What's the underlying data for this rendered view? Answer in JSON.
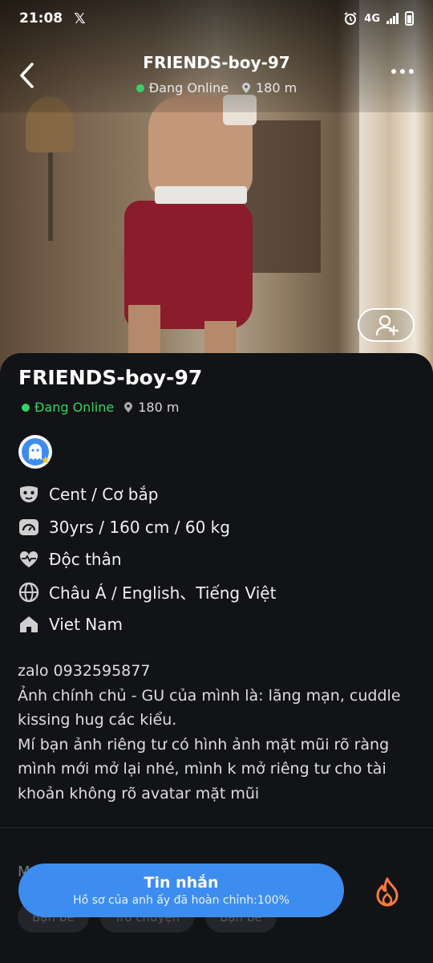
{
  "status_bar": {
    "time": "21:08",
    "network": "4G",
    "icons": [
      "x-app-icon",
      "alarm-icon",
      "signal-icon",
      "battery-icon"
    ]
  },
  "header": {
    "title": "FRIENDS-boy-97",
    "online": "Đang Online",
    "distance": "180 m"
  },
  "profile": {
    "name": "FRIENDS-boy-97",
    "online": "Đang Online",
    "distance": "180 m",
    "info": [
      {
        "icon": "mask-icon",
        "text": "Cent / Cơ bắp"
      },
      {
        "icon": "body-stats-icon",
        "text": "30yrs / 160 cm / 60 kg"
      },
      {
        "icon": "heart-pulse-icon",
        "text": "Độc thân"
      },
      {
        "icon": "globe-icon",
        "text": "Châu Á / English、Tiếng Việt"
      },
      {
        "icon": "home-icon",
        "text": "Viet Nam"
      }
    ],
    "bio": "zalo 0932595877\nẢnh chính chủ - GU của mình là: lãng mạn, cuddle kissing hug các kiểu.\nMí bạn ảnh riêng tư có hình ảnh mặt mũi rõ ràng mình mới mở lại nhé, mình k mở riêng tư cho tài khoản không rõ avatar mặt mũi"
  },
  "section": {
    "label": "M",
    "chips": [
      "Bạn bè",
      "Trò chuyện",
      "Bạn bè"
    ]
  },
  "cta": {
    "title": "Tin nhắn",
    "subtitle": "Hồ sơ của anh ấy đã hoàn chỉnh:100%"
  },
  "colors": {
    "accent": "#3d8df0",
    "online": "#33d266",
    "fire": "#ff7a3c",
    "background": "#121316"
  }
}
